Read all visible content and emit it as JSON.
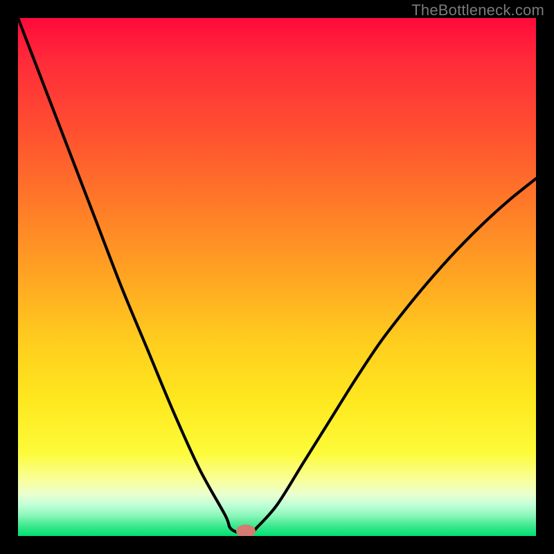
{
  "watermark": "TheBottleneck.com",
  "chart_data": {
    "type": "line",
    "title": "",
    "xlabel": "",
    "ylabel": "",
    "xlim": [
      0,
      100
    ],
    "ylim": [
      0,
      100
    ],
    "series": [
      {
        "name": "bottleneck-curve",
        "x": [
          0,
          5,
          10,
          15,
          20,
          25,
          30,
          35,
          40,
          41,
          43,
          45,
          46,
          50,
          55,
          60,
          65,
          70,
          75,
          80,
          85,
          90,
          95,
          100
        ],
        "y": [
          100,
          87,
          74,
          61,
          48,
          36,
          24,
          13,
          4,
          1.5,
          0.5,
          0.5,
          1.5,
          6,
          14,
          22,
          30,
          37.5,
          44,
          50,
          55.5,
          60.5,
          65,
          69
        ]
      }
    ],
    "marker": {
      "x": 44,
      "y": 0.9
    },
    "gradient_stops": [
      {
        "pct": 0,
        "color": "#ff0a3a"
      },
      {
        "pct": 50,
        "color": "#ffa522"
      },
      {
        "pct": 84,
        "color": "#fdfb3a"
      },
      {
        "pct": 100,
        "color": "#00e070"
      }
    ]
  }
}
